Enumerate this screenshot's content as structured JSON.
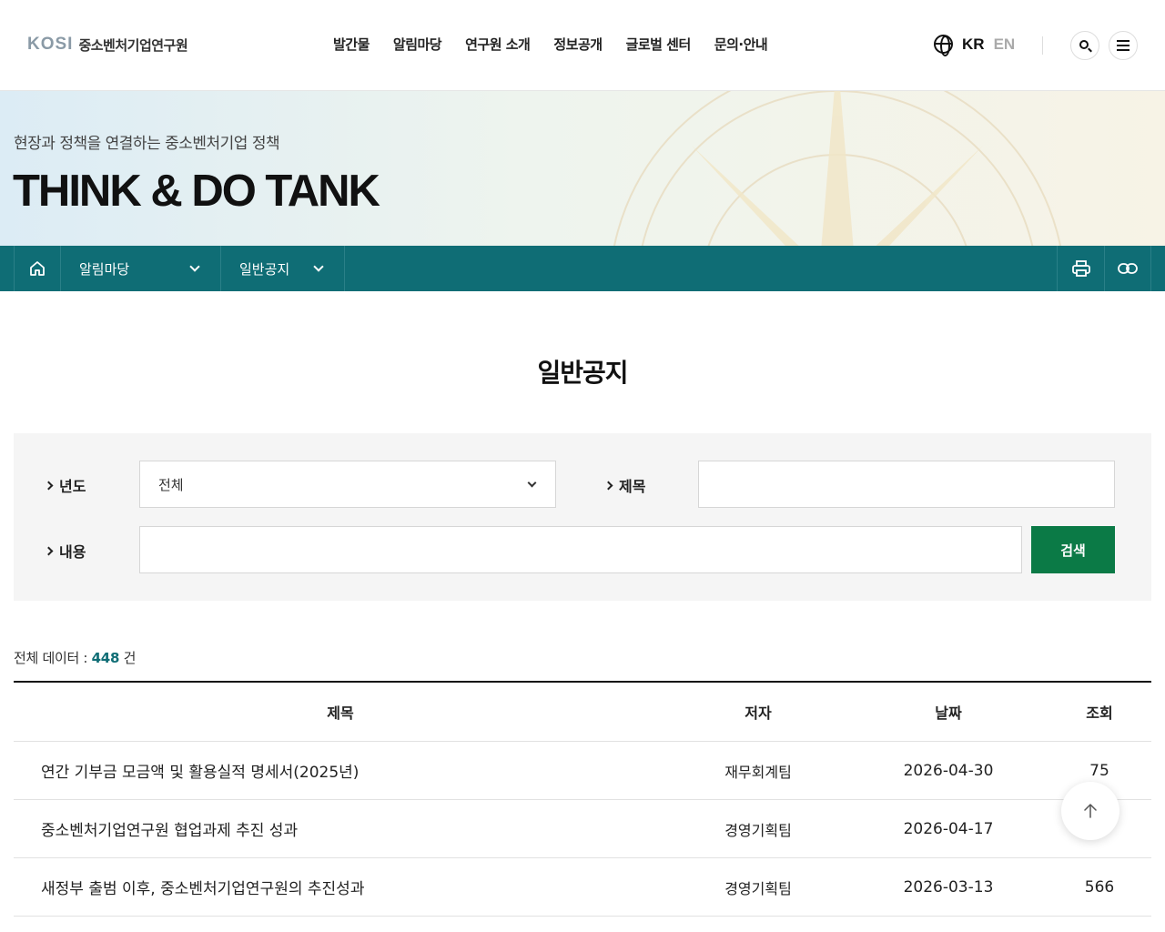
{
  "header": {
    "logo_mark": "KOSI",
    "logo_text": "중소벤처기업연구원",
    "nav": [
      "발간물",
      "알림마당",
      "연구원 소개",
      "정보공개",
      "글로벌 센터",
      "문의·안내"
    ],
    "lang_kr": "KR",
    "lang_en": "EN"
  },
  "banner": {
    "subtitle": "현장과 정책을 연결하는 중소벤처기업 정책",
    "title": "THINK & DO TANK"
  },
  "locbar": {
    "depth1": "알림마당",
    "depth2": "일반공지"
  },
  "page": {
    "title": "일반공지"
  },
  "search": {
    "year_label": "년도",
    "year_value": "전체",
    "title_label": "제목",
    "title_value": "",
    "content_label": "내용",
    "content_value": "",
    "button": "검색"
  },
  "count": {
    "label": "전체 데이터 :",
    "value": "448",
    "unit": "건"
  },
  "table": {
    "headers": {
      "title": "제목",
      "author": "저자",
      "date": "날짜",
      "views": "조회"
    },
    "rows": [
      {
        "title": "연간 기부금 모금액 및 활용실적 명세서(2025년)",
        "author": "재무회계팀",
        "date": "2026-04-30",
        "views": "75"
      },
      {
        "title": "중소벤처기업연구원 협업과제 추진 성과",
        "author": "경영기획팀",
        "date": "2026-04-17",
        "views": ""
      },
      {
        "title": "새정부 출범 이후, 중소벤처기업연구원의 추진성과",
        "author": "경영기획팀",
        "date": "2026-03-13",
        "views": "566"
      }
    ]
  },
  "colors": {
    "teal": "#0f6d75",
    "green_button": "#0b7a46"
  }
}
